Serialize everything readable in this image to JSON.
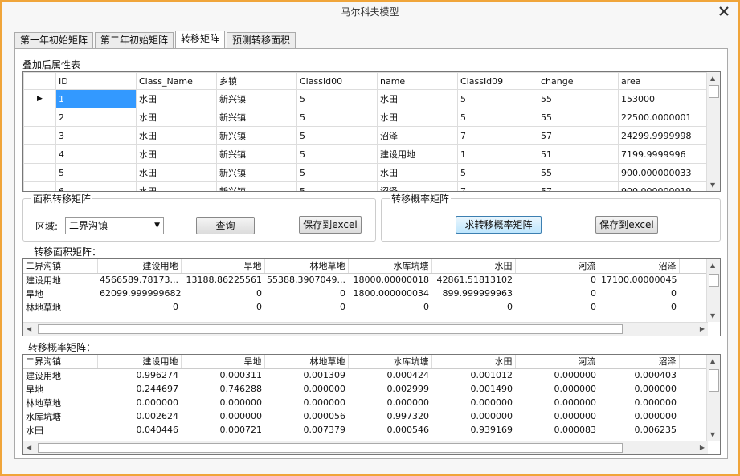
{
  "window": {
    "title": "马尔科夫模型"
  },
  "tabs": [
    "第一年初始矩阵",
    "第二年初始矩阵",
    "转移矩阵",
    "预测转移面积"
  ],
  "attr_table": {
    "label": "叠加后属性表",
    "columns": [
      "ID",
      "Class_Name",
      "乡镇",
      "ClassId00",
      "name",
      "ClassId09",
      "change",
      "area"
    ],
    "rows": [
      [
        "1",
        "水田",
        "新兴镇",
        "5",
        "水田",
        "5",
        "55",
        "153000"
      ],
      [
        "2",
        "水田",
        "新兴镇",
        "5",
        "水田",
        "5",
        "55",
        "22500.0000001"
      ],
      [
        "3",
        "水田",
        "新兴镇",
        "5",
        "沼泽",
        "7",
        "57",
        "24299.9999998"
      ],
      [
        "4",
        "水田",
        "新兴镇",
        "5",
        "建设用地",
        "1",
        "51",
        "7199.9999996"
      ],
      [
        "5",
        "水田",
        "新兴镇",
        "5",
        "水田",
        "5",
        "55",
        "900.000000033"
      ],
      [
        "6",
        "水田",
        "新兴镇",
        "5",
        "沼泽",
        "7",
        "57",
        "900.000000019"
      ]
    ]
  },
  "area_group": {
    "legend": "面积转移矩阵",
    "region_label": "区域:",
    "region_value": "二界沟镇",
    "query": "查询",
    "save": "保存到excel"
  },
  "prob_group": {
    "legend": "转移概率矩阵",
    "compute": "求转移概率矩阵",
    "save": "保存到excel"
  },
  "area_matrix": {
    "label": "转移面积矩阵：",
    "columns": [
      "二界沟镇",
      "建设用地",
      "旱地",
      "林地草地",
      "水库坑塘",
      "水田",
      "河流",
      "沼泽"
    ],
    "rows": [
      [
        "建设用地",
        "4566589.78173...",
        "13188.86225561",
        "55388.3907049...",
        "18000.00000018",
        "42861.51813102",
        "0",
        "17100.00000045"
      ],
      [
        "旱地",
        "62099.999999682",
        "0",
        "0",
        "1800.000000034",
        "899.999999963",
        "0",
        "0"
      ],
      [
        "林地草地",
        "0",
        "0",
        "0",
        "0",
        "0",
        "0",
        "0"
      ]
    ]
  },
  "prob_matrix": {
    "label": "转移概率矩阵：",
    "columns": [
      "二界沟镇",
      "建设用地",
      "旱地",
      "林地草地",
      "水库坑塘",
      "水田",
      "河流",
      "沼泽"
    ],
    "rows": [
      [
        "建设用地",
        "0.996274",
        "0.000311",
        "0.001309",
        "0.000424",
        "0.001012",
        "0.000000",
        "0.000403"
      ],
      [
        "旱地",
        "0.244697",
        "0.746288",
        "0.000000",
        "0.002999",
        "0.001490",
        "0.000000",
        "0.000000"
      ],
      [
        "林地草地",
        "0.000000",
        "0.000000",
        "0.000000",
        "0.000000",
        "0.000000",
        "0.000000",
        "0.000000"
      ],
      [
        "水库坑塘",
        "0.002624",
        "0.000000",
        "0.000056",
        "0.997320",
        "0.000000",
        "0.000000",
        "0.000000"
      ],
      [
        "水田",
        "0.040446",
        "0.000721",
        "0.007379",
        "0.000546",
        "0.939169",
        "0.000083",
        "0.006235"
      ]
    ]
  }
}
